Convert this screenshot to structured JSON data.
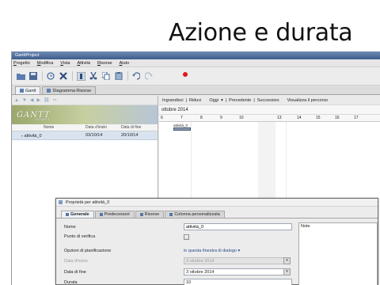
{
  "slide": {
    "title": "Azione e durata"
  },
  "window": {
    "title": "GanttProject"
  },
  "menu": [
    "Progetto",
    "Modifica",
    "Vista",
    "Attività",
    "Risorse",
    "Aiuto"
  ],
  "tabs": [
    {
      "label": "Gantt",
      "active": true
    },
    {
      "label": "Diagramma Risorse",
      "active": false
    }
  ],
  "logo": {
    "main": "GANTT",
    "sub": "project"
  },
  "task_table": {
    "columns": [
      "Nome",
      "Data d'inizio",
      "Data di fine"
    ],
    "rows": [
      {
        "name": "attività_0",
        "start": "03/10/14",
        "end": "20/10/14"
      }
    ]
  },
  "gantt_toolbar": {
    "left": [
      "Ingrandisci",
      "|",
      "Riduci"
    ],
    "nav": [
      "Oggi",
      "▾",
      "|",
      "Precedente",
      "|",
      "Successivo"
    ],
    "right": "Visualizza il percorso"
  },
  "timeline": {
    "month": "ottobre 2014",
    "days": [
      "6",
      "7",
      "8",
      "9",
      "10",
      "13",
      "14",
      "15",
      "16",
      "17"
    ],
    "bar_label": "attività_0"
  },
  "dialog": {
    "title": "Proprietà per attività_0",
    "tabs": [
      {
        "label": "Generale",
        "active": true
      },
      {
        "label": "Predecessori",
        "active": false
      },
      {
        "label": "Risorse",
        "active": false
      },
      {
        "label": "Colonna personalizzata",
        "active": false
      }
    ],
    "fields": {
      "name_label": "Nome",
      "name_value": "attività_0",
      "milestone_label": "Punto di verifica",
      "options_label": "Opzioni di pianificazione",
      "options_link": "in questa finestra di dialogo ▾",
      "start_label": "Data d'inizio",
      "start_value": "3 ottobre 2014",
      "end_label": "Data di fine",
      "end_value": "3 ottobre 2014",
      "duration_label": "Durata",
      "duration_value": "10"
    },
    "notes_label": "Note"
  },
  "colors": {
    "accent": "#5a7fb0",
    "task_bar": "#8a9bb4",
    "record": "#e0191c"
  }
}
